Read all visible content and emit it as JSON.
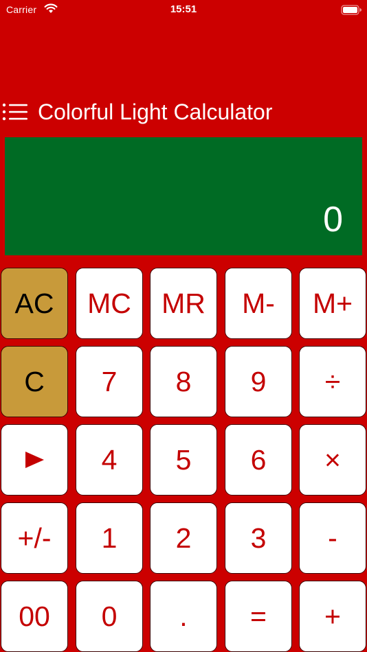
{
  "status_bar": {
    "carrier": "Carrier",
    "time": "15:51",
    "icons": [
      "wifi-icon",
      "battery-icon"
    ]
  },
  "header": {
    "title": "Colorful Light Calculator",
    "menu_icon": "menu-list-icon"
  },
  "display": {
    "value": "0"
  },
  "keys": {
    "row1": [
      "AC",
      "MC",
      "MR",
      "M-",
      "M+"
    ],
    "row2": [
      "C",
      "7",
      "8",
      "9",
      "÷"
    ],
    "row3": [
      "play-icon",
      "4",
      "5",
      "6",
      "×"
    ],
    "row4": [
      "+/-",
      "1",
      "2",
      "3",
      "-"
    ],
    "row5": [
      "00",
      "0",
      ".",
      "=",
      "+"
    ]
  },
  "colors": {
    "background": "#cc0000",
    "display": "#006b24",
    "key": "#ffffff",
    "key_text": "#c40000",
    "gold_key": "#c89a3a"
  }
}
